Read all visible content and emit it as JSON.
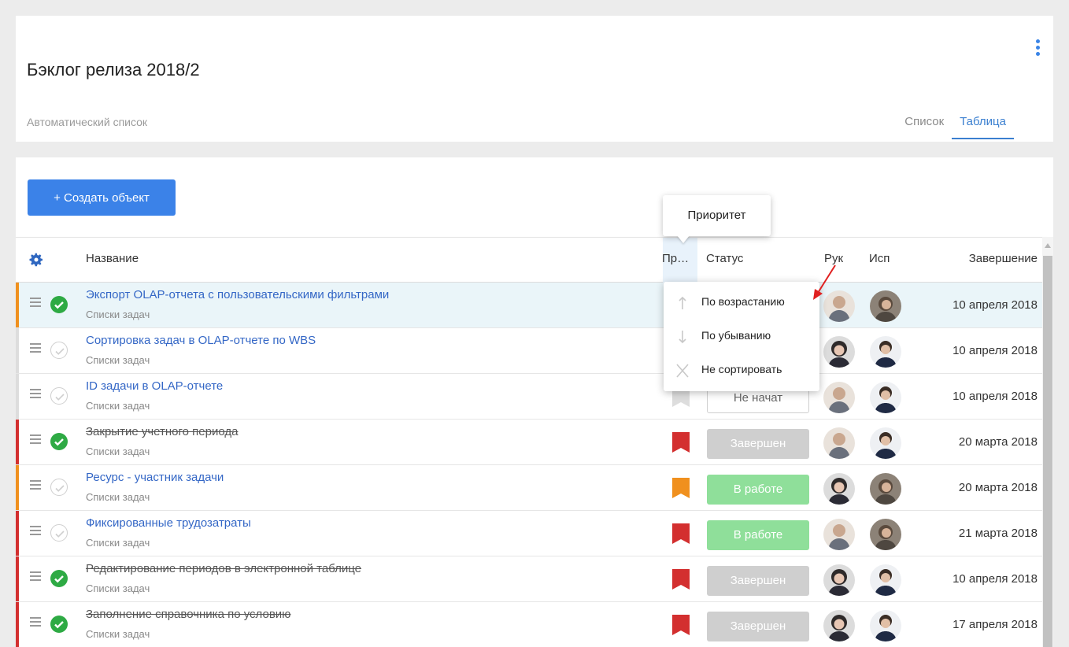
{
  "header": {
    "title": "Бэклог релиза 2018/2",
    "subtitle": "Автоматический список",
    "tabs": [
      {
        "label": "Список",
        "active": false
      },
      {
        "label": "Таблица",
        "active": true
      }
    ]
  },
  "toolbar": {
    "create_label": "+ Создать объект"
  },
  "table": {
    "columns": {
      "name": "Название",
      "priority": "Пр…",
      "status": "Статус",
      "owner": "Рук",
      "executor": "Исп",
      "due": "Завершение"
    },
    "rows": [
      {
        "title": "Экспорт OLAP-отчета с пользовательскими фильтрами",
        "sub": "Списки задач",
        "date": "10 апреля 2018",
        "status": ""
      },
      {
        "title": "Сортировка задач в OLAP-отчете по WBS",
        "sub": "Списки задач",
        "date": "10 апреля 2018",
        "status": ""
      },
      {
        "title": "ID задачи в OLAP-отчете",
        "sub": "Списки задач",
        "date": "10 апреля 2018",
        "status": "Не начат"
      },
      {
        "title": "Закрытие учетного периода",
        "sub": "Списки задач",
        "date": "20 марта 2018",
        "status": "Завершен"
      },
      {
        "title": "Ресурс - участник задачи",
        "sub": "Списки задач",
        "date": "20 марта 2018",
        "status": "В работе"
      },
      {
        "title": "Фиксированные трудозатраты",
        "sub": "Списки задач",
        "date": "21 марта 2018",
        "status": "В работе"
      },
      {
        "title": "Редактирование периодов в электронной таблице",
        "sub": "Списки задач",
        "date": "10 апреля 2018",
        "status": "Завершен"
      },
      {
        "title": "Заполнение справочника по условию",
        "sub": "Списки задач",
        "date": "17 апреля 2018",
        "status": "Завершен"
      }
    ]
  },
  "tooltip": {
    "text": "Приоритет"
  },
  "sort_menu": {
    "asc": "По возрастанию",
    "desc": "По убыванию",
    "none": "Не сортировать"
  },
  "colors": {
    "accent": "#3b82e8",
    "high_priority": "#d32f2f",
    "medium_priority": "#f0901e",
    "low_priority": "#dddddd",
    "done_check": "#2eaa44",
    "in_progress": "#8fdf9a",
    "completed": "#cfcfcf"
  }
}
